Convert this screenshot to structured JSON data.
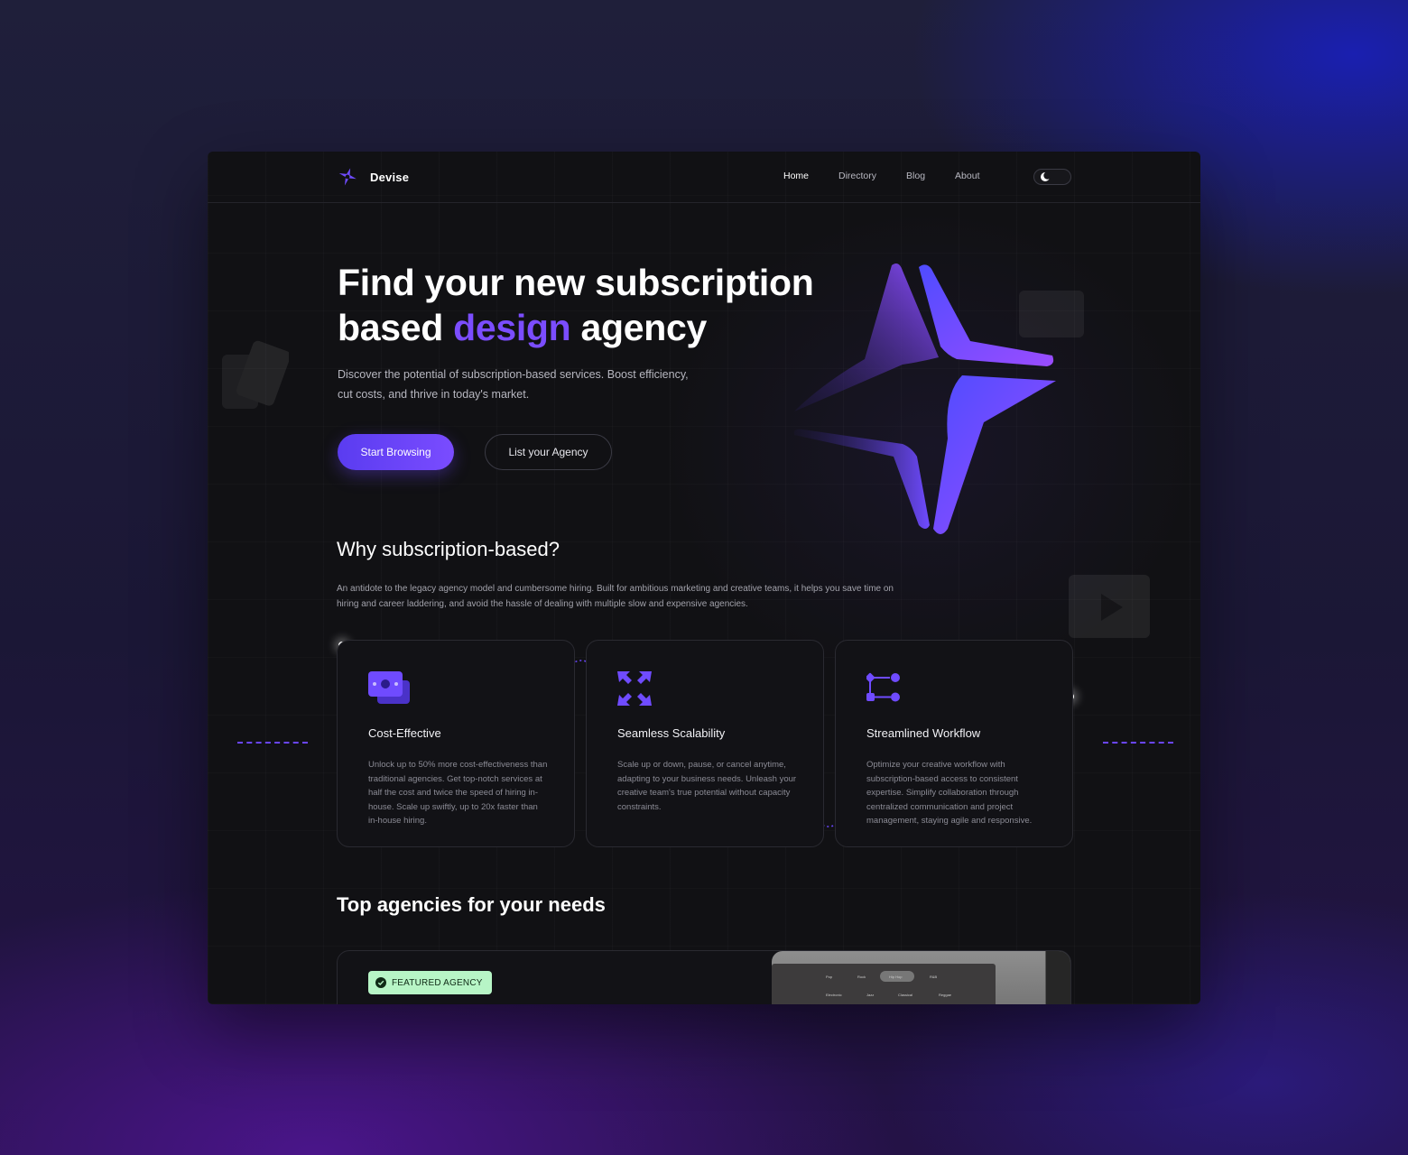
{
  "brand": {
    "name": "Devise",
    "accent": "#7b4dff"
  },
  "nav": {
    "links": [
      "Home",
      "Directory",
      "Blog",
      "About"
    ],
    "active": "Home",
    "theme_toggle_icon": "moon-icon"
  },
  "hero": {
    "title_line1": "Find your new subscription",
    "title_pre": "based ",
    "title_accent": "design",
    "title_post": " agency",
    "subtitle": "Discover the potential of subscription-based services. Boost efficiency, cut costs, and thrive in today's market.",
    "primary_button": "Start Browsing",
    "secondary_button": "List your Agency"
  },
  "why": {
    "title": "Why subscription-based?",
    "text": "An antidote to the legacy agency model and cumbersome hiring. Built for ambitious marketing and creative teams, it helps you save time on hiring and career laddering, and avoid the hassle of dealing with multiple slow and expensive agencies.",
    "cards": [
      {
        "icon": "money-icon",
        "title": "Cost-Effective",
        "text": "Unlock up to 50% more cost-effectiveness than traditional agencies. Get top-notch services at half the cost and twice the speed of hiring in-house. Scale up swiftly, up to 20x faster than in-house hiring."
      },
      {
        "icon": "expand-arrows-icon",
        "title": "Seamless Scalability",
        "text": "Scale up or down, pause, or cancel anytime, adapting to your business needs. Unleash your creative team's true potential without capacity constraints."
      },
      {
        "icon": "workflow-icon",
        "title": "Streamlined Workflow",
        "text": "Optimize your creative workflow with subscription-based access to consistent expertise. Simplify collaboration through centralized communication and project management, staying agile and responsive."
      }
    ]
  },
  "agencies": {
    "title": "Top agencies for your needs",
    "badge": "FEATURED AGENCY",
    "badge_icon": "verified-check-icon",
    "preview_labels": [
      "Pop",
      "Rock",
      "Hip Hop",
      "R&B",
      "Electronic",
      "Jazz",
      "Classical",
      "Reggae"
    ]
  }
}
